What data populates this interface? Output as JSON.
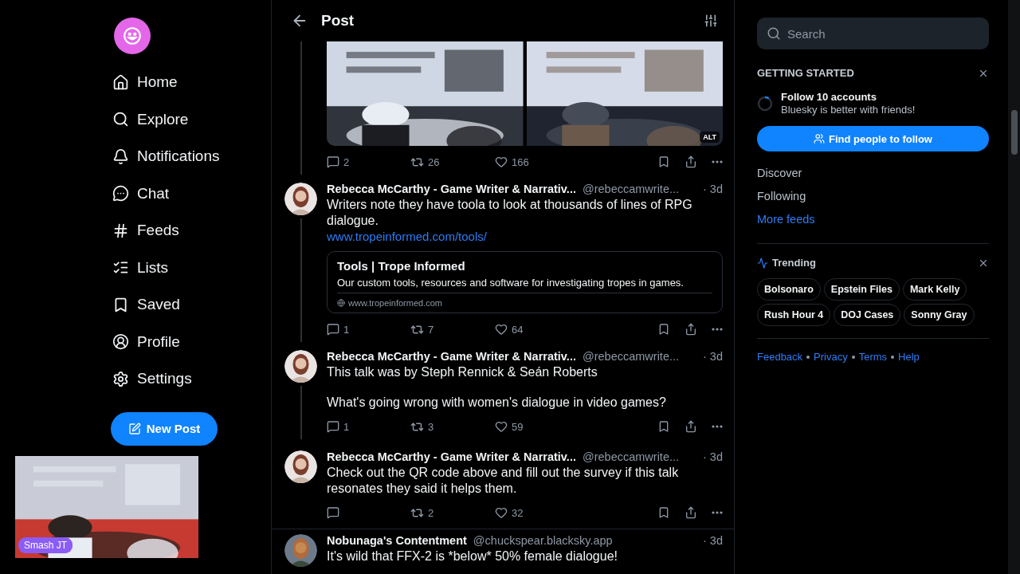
{
  "nav": {
    "items": [
      {
        "label": "Home"
      },
      {
        "label": "Explore"
      },
      {
        "label": "Notifications"
      },
      {
        "label": "Chat"
      },
      {
        "label": "Feeds"
      },
      {
        "label": "Lists"
      },
      {
        "label": "Saved"
      },
      {
        "label": "Profile"
      },
      {
        "label": "Settings"
      }
    ],
    "new_post": "New Post"
  },
  "webcam": {
    "kind": "picture",
    "badge": "Smash JT"
  },
  "header": {
    "title": "Post"
  },
  "posts": [
    {
      "kind": "media",
      "media": [
        {
          "kind": "picture"
        },
        {
          "kind": "picture",
          "alt": "ALT"
        }
      ],
      "actions": {
        "replies": "2",
        "reposts": "26",
        "likes": "166"
      }
    },
    {
      "kind": "text",
      "author": "Rebecca McCarthy - Game Writer & Narrativ...",
      "handle": "@rebeccamwrite...",
      "time": "· 3d",
      "paragraphs": [
        "Writers note they have toola to look at thousands of lines of RPG dialogue."
      ],
      "link": "www.tropeinformed.com/tools/",
      "card": {
        "title": "Tools | Trope Informed",
        "description": "Our custom tools, resources and software for investigating tropes in games.",
        "domain": "www.tropeinformed.com"
      },
      "actions": {
        "replies": "1",
        "reposts": "7",
        "likes": "64"
      },
      "thread": true
    },
    {
      "kind": "text",
      "author": "Rebecca McCarthy - Game Writer & Narrativ...",
      "handle": "@rebeccamwrite...",
      "time": "· 3d",
      "paragraphs": [
        "This talk was by Steph Rennick & Seán Roberts",
        "What's going wrong with women's dialogue in video games?"
      ],
      "actions": {
        "replies": "1",
        "reposts": "3",
        "likes": "59"
      },
      "thread": true
    },
    {
      "kind": "text",
      "author": "Rebecca McCarthy - Game Writer & Narrativ...",
      "handle": "@rebeccamwrite...",
      "time": "· 3d",
      "paragraphs": [
        "Check out the QR code above and fill out the survey if this talk resonates they said it helps them."
      ],
      "actions": {
        "reposts": "2",
        "likes": "32"
      },
      "thread": false
    },
    {
      "kind": "text",
      "author": "Nobunaga's Contentment",
      "handle": "@chuckspear.blacksky.app",
      "time": "· 3d",
      "paragraphs": [
        "It's wild that FFX-2 is *below* 50% female dialogue!"
      ],
      "thread": false
    }
  ],
  "sidebar": {
    "search": {
      "placeholder": "Search"
    },
    "getting_started": {
      "heading": "GETTING STARTED",
      "task": "Follow 10 accounts",
      "subtitle": "Bluesky is better with friends!",
      "button": "Find people to follow"
    },
    "feeds": [
      {
        "label": "Discover",
        "kind": "plain"
      },
      {
        "label": "Following",
        "kind": "plain"
      },
      {
        "label": "More feeds",
        "kind": "link"
      }
    ],
    "trending": {
      "title": "Trending",
      "tags": [
        "Bolsonaro",
        "Epstein Files",
        "Mark Kelly",
        "Rush Hour 4",
        "DOJ Cases",
        "Sonny Gray"
      ]
    },
    "footer": [
      "Feedback",
      "Privacy",
      "Terms",
      "Help"
    ]
  }
}
